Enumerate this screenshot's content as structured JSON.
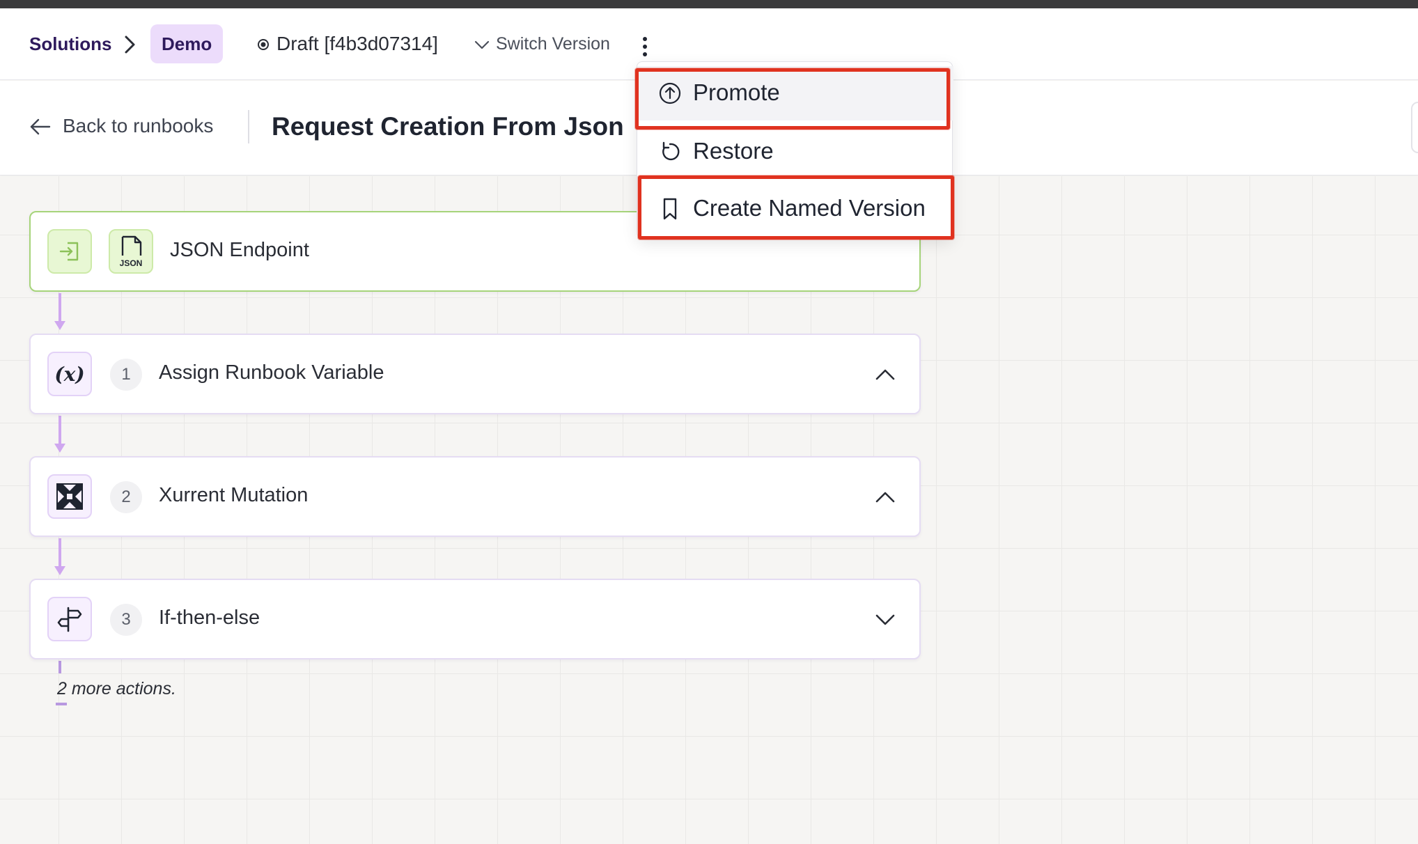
{
  "breadcrumb": {
    "solutions": "Solutions",
    "current": "Demo"
  },
  "version": {
    "draft": "Draft [f4b3d07314]",
    "switch": "Switch Version"
  },
  "subheader": {
    "back": "Back to runbooks",
    "title": "Request Creation From Json"
  },
  "trigger": {
    "label": "JSON Endpoint",
    "file_icon_text": "JSON"
  },
  "steps": [
    {
      "number": "1",
      "label": "Assign Runbook Variable",
      "icon": "variable-icon",
      "icon_text": "(x)",
      "expanded": true
    },
    {
      "number": "2",
      "label": "Xurrent Mutation",
      "icon": "xurrent-logo-icon",
      "expanded": true
    },
    {
      "number": "3",
      "label": "If-then-else",
      "icon": "signpost-icon",
      "expanded": false
    }
  ],
  "more_actions": "2 more actions.",
  "menu": {
    "items": [
      {
        "label": "Promote",
        "icon": "arrow-up-circle-icon"
      },
      {
        "label": "Restore",
        "icon": "restore-icon"
      },
      {
        "label": "Create Named Version",
        "icon": "bookmark-icon"
      }
    ]
  },
  "colors": {
    "accent_purple": "#ecdcfb",
    "trigger_green": "#a6d47a",
    "connector": "#cfa7ef",
    "highlight_red": "#e0321f"
  }
}
